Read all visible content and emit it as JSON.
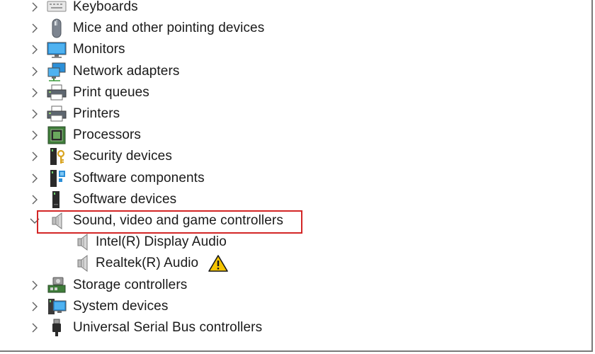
{
  "tree": {
    "items": [
      {
        "label": "Keyboards",
        "icon": "keyboard-icon",
        "expanded": false
      },
      {
        "label": "Mice and other pointing devices",
        "icon": "mouse-icon",
        "expanded": false
      },
      {
        "label": "Monitors",
        "icon": "monitor-icon",
        "expanded": false
      },
      {
        "label": "Network adapters",
        "icon": "network-adapter-icon",
        "expanded": false
      },
      {
        "label": "Print queues",
        "icon": "print-queue-icon",
        "expanded": false
      },
      {
        "label": "Printers",
        "icon": "printer-icon",
        "expanded": false
      },
      {
        "label": "Processors",
        "icon": "processor-icon",
        "expanded": false
      },
      {
        "label": "Security devices",
        "icon": "security-device-icon",
        "expanded": false
      },
      {
        "label": "Software components",
        "icon": "software-component-icon",
        "expanded": false
      },
      {
        "label": "Software devices",
        "icon": "software-device-icon",
        "expanded": false
      },
      {
        "label": "Sound, video and game controllers",
        "icon": "speaker-icon",
        "expanded": true,
        "children": [
          {
            "label": "Intel(R) Display Audio",
            "icon": "speaker-icon",
            "warning": false
          },
          {
            "label": "Realtek(R) Audio",
            "icon": "speaker-icon",
            "warning": true
          }
        ]
      },
      {
        "label": "Storage controllers",
        "icon": "storage-controller-icon",
        "expanded": false
      },
      {
        "label": "System devices",
        "icon": "system-device-icon",
        "expanded": false
      },
      {
        "label": "Universal Serial Bus controllers",
        "icon": "usb-icon",
        "expanded": false
      }
    ]
  },
  "colors": {
    "highlight_border": "#d32626",
    "warning": "#f5c400",
    "chevron": "#5f5f5f"
  }
}
